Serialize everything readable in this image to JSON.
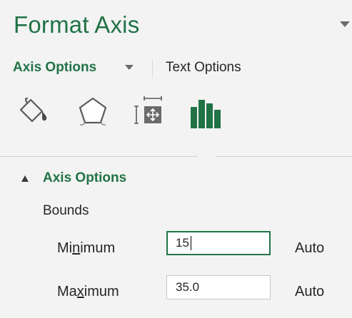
{
  "pane": {
    "title": "Format Axis",
    "tabs": [
      {
        "label": "Axis Options",
        "selected": true
      },
      {
        "label": "Text Options",
        "selected": false
      }
    ],
    "icons": [
      "fill-line-icon",
      "effects-icon",
      "size-properties-icon",
      "axis-options-icon"
    ],
    "accent_color": "#217346"
  },
  "section": {
    "title": "Axis Options",
    "group_label": "Bounds",
    "fields": {
      "minimum": {
        "label_before": "Mi",
        "mnemonic": "n",
        "label_after": "imum",
        "value": "15",
        "auto_label": "Auto"
      },
      "maximum": {
        "label_before": "Ma",
        "mnemonic": "x",
        "label_after": "imum",
        "value": "35.0",
        "auto_label": "Auto"
      }
    }
  }
}
